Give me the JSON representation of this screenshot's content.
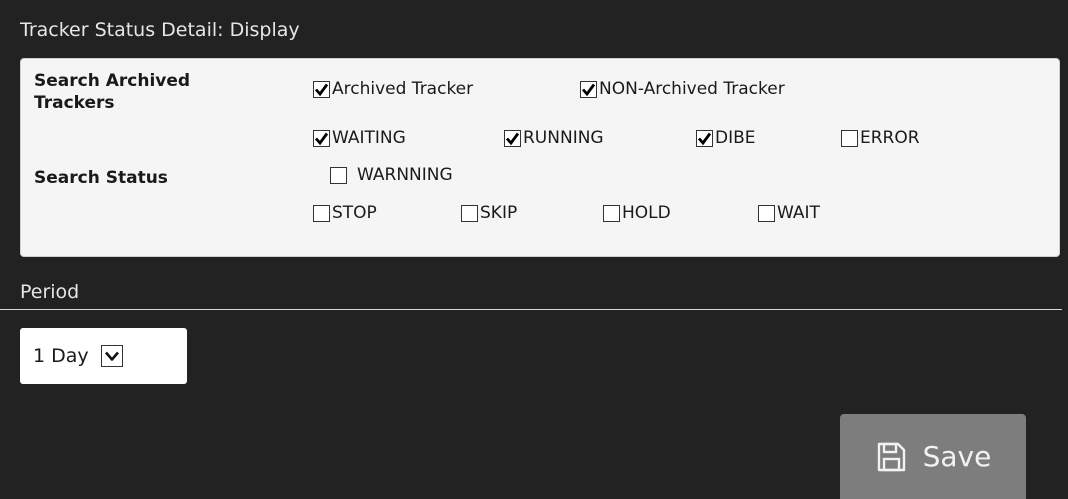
{
  "header": {
    "title": "Tracker Status Detail:  Display"
  },
  "archive": {
    "label": "Search Archived Trackers",
    "options": [
      {
        "label": "Archived Tracker",
        "checked": true
      },
      {
        "label": "NON-Archived Tracker",
        "checked": true
      }
    ]
  },
  "status": {
    "label": "Search Status",
    "options": [
      {
        "label": "WAITING",
        "checked": true
      },
      {
        "label": "RUNNING",
        "checked": true
      },
      {
        "label": "DIBE",
        "checked": true
      },
      {
        "label": "ERROR",
        "checked": false
      },
      {
        "label": "WARNNING",
        "checked": false
      },
      {
        "label": "STOP",
        "checked": false
      },
      {
        "label": "SKIP",
        "checked": false
      },
      {
        "label": "HOLD",
        "checked": false
      },
      {
        "label": "WAIT",
        "checked": false
      }
    ]
  },
  "period": {
    "label": "Period",
    "selected": "1 Day"
  },
  "actions": {
    "save_label": "Save",
    "save_icon": "floppy-disk-icon"
  }
}
